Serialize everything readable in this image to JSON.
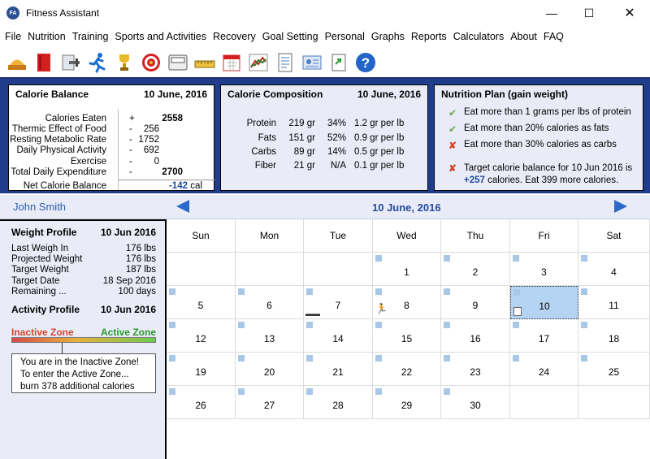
{
  "window": {
    "title": "Fitness Assistant",
    "app_icon_text": "FA"
  },
  "menu": [
    "File",
    "Nutrition",
    "Training",
    "Sports and Activities",
    "Recovery",
    "Goal Setting",
    "Personal",
    "Graphs",
    "Reports",
    "Calculators",
    "About",
    "FAQ"
  ],
  "toolbar_icons": [
    "food-icon",
    "recipe-book-icon",
    "weights-icon",
    "running-icon",
    "trophy-icon",
    "target-icon",
    "scale-icon",
    "ruler-icon",
    "calendar-icon",
    "graph-icon",
    "document-icon",
    "profile-card-icon",
    "export-icon",
    "help-icon"
  ],
  "calorie_balance": {
    "title": "Calorie Balance",
    "date": "10 June, 2016",
    "rows": [
      {
        "label": "Calories Eaten",
        "sign": "+",
        "value": "2558"
      },
      {
        "label": "Thermic Effect of Food",
        "sign": "-",
        "value": "256"
      },
      {
        "label": "Resting Metabolic Rate",
        "sign": "-",
        "value": "1752"
      },
      {
        "label": "Daily Physical Activity",
        "sign": "-",
        "value": "692"
      },
      {
        "label": "Exercise",
        "sign": "-",
        "value": "0"
      },
      {
        "label": "Total Daily Expenditure",
        "sign": "-",
        "value": "2700"
      }
    ],
    "net_label": "Net Calorie Balance",
    "net_value": "-142",
    "net_unit": "cal"
  },
  "calorie_composition": {
    "title": "Calorie Composition",
    "date": "10 June, 2016",
    "rows": [
      {
        "name": "Protein",
        "grams": "219 gr",
        "pct": "34%",
        "per": "1.2 gr per lb"
      },
      {
        "name": "Fats",
        "grams": "151 gr",
        "pct": "52%",
        "per": "0.9 gr per lb"
      },
      {
        "name": "Carbs",
        "grams": "89 gr",
        "pct": "14%",
        "per": "0.5 gr per lb"
      },
      {
        "name": "Fiber",
        "grams": "21 gr",
        "pct": "N/A",
        "per": "0.1 gr per lb"
      }
    ]
  },
  "nutrition_plan": {
    "title": "Nutrition Plan  (gain weight)",
    "items": [
      {
        "status": "check",
        "text": "Eat more than 1 grams per lbs of protein"
      },
      {
        "status": "check",
        "text": "Eat more than 20% calories as fats"
      },
      {
        "status": "cross",
        "text": "Eat more than 30% calories as carbs"
      }
    ],
    "target_line1": "Target calorie balance for 10 Jun 2016 is",
    "target_value": "+257",
    "target_line2": " calories. Eat 399 more calories."
  },
  "nav": {
    "user_name": "John Smith",
    "current_date": "10 June, 2016"
  },
  "weight_profile": {
    "title": "Weight Profile",
    "date": "10 Jun 2016",
    "rows": [
      {
        "label": "Last Weigh In",
        "value": "176 lbs"
      },
      {
        "label": "Projected Weight",
        "value": "176 lbs"
      },
      {
        "label": "Target Weight",
        "value": "187 lbs"
      },
      {
        "label": "Target Date",
        "value": "18 Sep 2016"
      },
      {
        "label": "Remaining ...",
        "value": "100 days"
      }
    ]
  },
  "activity_profile": {
    "title": "Activity Profile",
    "date": "10 Jun 2016",
    "inactive_label": "Inactive Zone",
    "active_label": "Active Zone",
    "level": 0.35,
    "tip_line1": "You are in the Inactive Zone!",
    "tip_line2": "To enter the Active Zone...",
    "tip_line3": "burn 378 additional calories"
  },
  "calendar": {
    "weekdays": [
      "Sun",
      "Mon",
      "Tue",
      "Wed",
      "Thu",
      "Fri",
      "Sat"
    ],
    "weeks": [
      [
        "",
        "",
        "",
        "1",
        "2",
        "3",
        "4"
      ],
      [
        "5",
        "6",
        "7",
        "8",
        "9",
        "10",
        "11"
      ],
      [
        "12",
        "13",
        "14",
        "15",
        "16",
        "17",
        "18"
      ],
      [
        "19",
        "20",
        "21",
        "22",
        "23",
        "24",
        "25"
      ],
      [
        "26",
        "27",
        "28",
        "29",
        "30",
        "",
        ""
      ]
    ],
    "selected": "10"
  }
}
